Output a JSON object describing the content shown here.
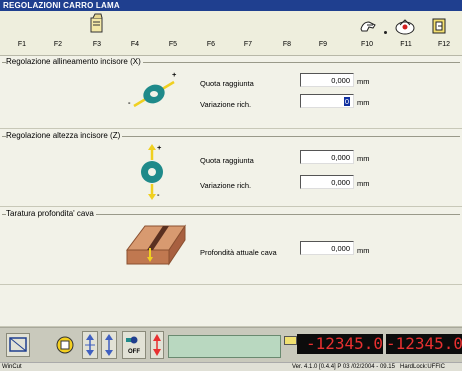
{
  "window": {
    "title": "REGOLAZIONI CARRO LAMA"
  },
  "fkeys": [
    "F1",
    "F2",
    "F3",
    "F4",
    "F5",
    "F6",
    "F7",
    "F8",
    "F9",
    "F10",
    "F11",
    "F12"
  ],
  "icons": {
    "f3": "folder-icon",
    "f10": "hand-icon",
    "f11": "home-icon",
    "f12": "exit-icon"
  },
  "sections": {
    "allineamento": {
      "title": "Regolazione allineamento incisore (X)",
      "quota_label": "Quota raggiunta",
      "quota_value": "0,000",
      "variazione_label": "Variazione rich.",
      "variazione_value": "0",
      "unit": "mm",
      "plus": "+",
      "minus": "-"
    },
    "altezza": {
      "title": "Regolazione altezza incisore (Z)",
      "quota_label": "Quota raggiunta",
      "quota_value": "0,000",
      "variazione_label": "Variazione rich.",
      "variazione_value": "0,000",
      "unit": "mm",
      "plus": "+",
      "minus": "-"
    },
    "taratura": {
      "title": "Taratura profondita' cava",
      "profondita_label": "Profondità attuale cava",
      "profondita_value": "0,000",
      "unit": "mm"
    }
  },
  "bottom": {
    "off_label": "OFF",
    "lcd1": "-12345.0",
    "lcd2": "-12345.0"
  },
  "status": {
    "left": "WinCut",
    "right": "Ver. 4.1.0 [0.4.4] P 03 /02/2004 - 09.15",
    "lock": "HardLock:UFFIC"
  },
  "colors": {
    "accent": "#1f3f8f",
    "lcd_text": "#e83030",
    "rotor": "#1f8a8a",
    "arrow": "#f0d020"
  }
}
